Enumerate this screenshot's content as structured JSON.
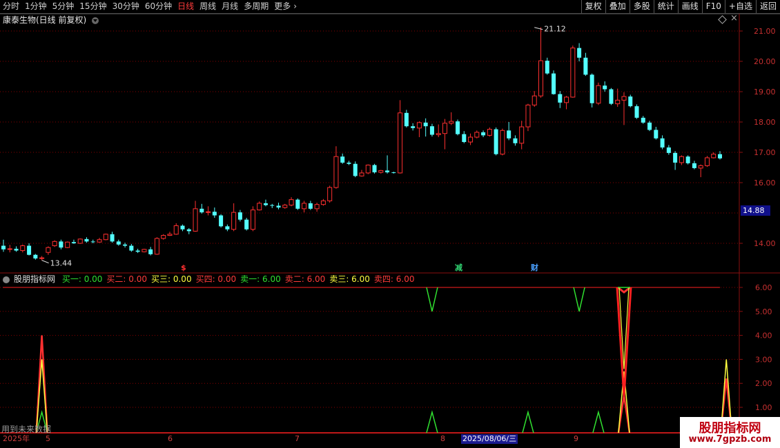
{
  "toolbar": {
    "periods": [
      "分时",
      "1分钟",
      "5分钟",
      "15分钟",
      "30分钟",
      "60分钟",
      "日线",
      "周线",
      "月线",
      "多周期",
      "更多"
    ],
    "active_period": "日线",
    "right_buttons": [
      "复权",
      "叠加",
      "多股",
      "统计",
      "画线",
      "F10",
      "+自选",
      "返回"
    ],
    "more_arrow": "›"
  },
  "main_chart": {
    "title": "康泰生物(日线 前复权)",
    "high_label": "21.12",
    "low_label": "13.44",
    "current_price": "14.88",
    "y_ticks": [
      "21.00",
      "20.00",
      "19.00",
      "18.00",
      "17.00",
      "16.00",
      "14.00"
    ],
    "markers": [
      {
        "label": "$",
        "color": "#ff3030"
      },
      {
        "label": "减",
        "color": "#30d070"
      },
      {
        "label": "财",
        "color": "#4aa0ff"
      }
    ],
    "close_symbol": "×"
  },
  "indicator": {
    "name": "股朋指标网",
    "values": [
      {
        "label": "买一: 0.00",
        "color": "#30e030"
      },
      {
        "label": "买二: 0.00",
        "color": "#ff3b3b"
      },
      {
        "label": "买三: 0.00",
        "color": "#ffff40"
      },
      {
        "label": "买四: 0.00",
        "color": "#ff3b3b"
      },
      {
        "label": "卖一: 6.00",
        "color": "#30e030"
      },
      {
        "label": "卖二: 6.00",
        "color": "#ff3b3b"
      },
      {
        "label": "卖三: 6.00",
        "color": "#ffff40"
      },
      {
        "label": "卖四: 6.00",
        "color": "#ff3b3b"
      }
    ],
    "y_ticks": [
      "6.00",
      "5.00",
      "4.00",
      "3.00",
      "2.00",
      "1.00"
    ]
  },
  "footer_note": "用到未来数据",
  "date_axis": {
    "labels": [
      "2025年",
      "5",
      "6",
      "7",
      "8",
      "2025/08/06/三",
      "9"
    ]
  },
  "watermark": {
    "title": "股朋指标网",
    "url": "www.7gpzb.com"
  },
  "colors": {
    "up": "#ff3030",
    "down": "#54ffff",
    "grid": "#8b0000",
    "accent": "#10108a"
  },
  "chart_data": {
    "type": "candlestick",
    "ylim": [
      13.2,
      21.5
    ],
    "ohlc": [
      [
        13.92,
        14.12,
        13.72,
        13.8
      ],
      [
        13.8,
        13.95,
        13.7,
        13.82
      ],
      [
        13.82,
        13.9,
        13.72,
        13.76
      ],
      [
        13.76,
        13.96,
        13.7,
        13.92
      ],
      [
        13.92,
        14.0,
        13.6,
        13.62
      ],
      [
        13.62,
        13.65,
        13.46,
        13.5
      ],
      [
        13.5,
        13.58,
        13.44,
        13.52
      ],
      [
        13.7,
        13.9,
        13.62,
        13.86
      ],
      [
        13.92,
        14.1,
        13.88,
        14.06
      ],
      [
        14.06,
        14.12,
        13.8,
        13.86
      ],
      [
        13.86,
        14.06,
        13.84,
        14.04
      ],
      [
        14.04,
        14.12,
        13.98,
        14.0
      ],
      [
        14.0,
        14.16,
        13.98,
        14.14
      ],
      [
        14.14,
        14.2,
        14.02,
        14.06
      ],
      [
        14.06,
        14.12,
        14.0,
        14.04
      ],
      [
        14.04,
        14.18,
        14.02,
        14.12
      ],
      [
        14.12,
        14.32,
        14.1,
        14.3
      ],
      [
        14.3,
        14.38,
        14.02,
        14.06
      ],
      [
        14.06,
        14.12,
        13.92,
        13.96
      ],
      [
        13.96,
        14.02,
        13.86,
        13.92
      ],
      [
        13.92,
        13.98,
        13.72,
        13.76
      ],
      [
        13.76,
        13.82,
        13.68,
        13.72
      ],
      [
        13.72,
        13.82,
        13.7,
        13.8
      ],
      [
        13.8,
        13.88,
        13.6,
        13.64
      ],
      [
        13.64,
        14.2,
        13.62,
        14.16
      ],
      [
        14.16,
        14.3,
        14.12,
        14.26
      ],
      [
        14.26,
        14.38,
        14.24,
        14.3
      ],
      [
        14.3,
        14.66,
        14.28,
        14.58
      ],
      [
        14.58,
        14.62,
        14.4,
        14.46
      ],
      [
        14.46,
        14.5,
        14.3,
        14.4
      ],
      [
        14.4,
        15.4,
        14.38,
        15.14
      ],
      [
        15.14,
        15.3,
        14.98,
        15.02
      ],
      [
        15.02,
        15.22,
        14.92,
        15.04
      ],
      [
        15.04,
        15.18,
        14.84,
        14.92
      ],
      [
        14.92,
        14.96,
        14.52,
        14.56
      ],
      [
        14.56,
        14.62,
        14.4,
        14.46
      ],
      [
        14.46,
        15.32,
        14.4,
        15.02
      ],
      [
        15.02,
        15.1,
        14.72,
        14.78
      ],
      [
        14.78,
        14.84,
        14.42,
        14.46
      ],
      [
        14.46,
        15.22,
        14.4,
        15.1
      ],
      [
        15.1,
        15.38,
        15.08,
        15.32
      ],
      [
        15.32,
        15.44,
        15.22,
        15.26
      ],
      [
        15.26,
        15.3,
        15.16,
        15.24
      ],
      [
        15.24,
        15.34,
        15.12,
        15.18
      ],
      [
        15.18,
        15.3,
        15.14,
        15.26
      ],
      [
        15.26,
        15.52,
        15.22,
        15.44
      ],
      [
        15.44,
        15.48,
        15.1,
        15.14
      ],
      [
        15.14,
        15.4,
        15.02,
        15.32
      ],
      [
        15.32,
        15.4,
        15.1,
        15.14
      ],
      [
        15.14,
        15.34,
        15.04,
        15.28
      ],
      [
        15.28,
        15.46,
        15.24,
        15.4
      ],
      [
        15.4,
        15.9,
        15.34,
        15.84
      ],
      [
        15.84,
        17.2,
        15.8,
        16.86
      ],
      [
        16.86,
        16.96,
        16.62,
        16.66
      ],
      [
        16.66,
        16.72,
        16.58,
        16.62
      ],
      [
        16.62,
        16.7,
        16.18,
        16.22
      ],
      [
        16.22,
        16.42,
        16.2,
        16.32
      ],
      [
        16.32,
        16.6,
        16.28,
        16.58
      ],
      [
        16.58,
        16.62,
        16.3,
        16.34
      ],
      [
        16.34,
        16.42,
        16.3,
        16.4
      ],
      [
        16.4,
        16.9,
        16.3,
        16.34
      ],
      [
        16.34,
        16.36,
        16.3,
        16.32
      ],
      [
        16.32,
        18.72,
        16.3,
        18.3
      ],
      [
        18.3,
        18.4,
        17.82,
        17.86
      ],
      [
        17.86,
        17.96,
        17.72,
        17.8
      ],
      [
        17.8,
        18.02,
        17.5,
        17.98
      ],
      [
        17.98,
        18.12,
        17.52,
        17.86
      ],
      [
        17.86,
        17.94,
        17.52,
        17.58
      ],
      [
        17.58,
        17.92,
        17.5,
        17.62
      ],
      [
        17.62,
        18.1,
        17.1,
        17.96
      ],
      [
        17.96,
        18.32,
        17.9,
        18.02
      ],
      [
        18.02,
        18.08,
        17.56,
        17.6
      ],
      [
        17.6,
        17.7,
        17.3,
        17.34
      ],
      [
        17.34,
        17.62,
        17.24,
        17.5
      ],
      [
        17.5,
        17.72,
        17.46,
        17.66
      ],
      [
        17.66,
        17.72,
        17.5,
        17.56
      ],
      [
        17.56,
        17.82,
        17.52,
        17.76
      ],
      [
        17.76,
        17.82,
        16.9,
        16.94
      ],
      [
        16.94,
        17.78,
        16.9,
        17.72
      ],
      [
        17.72,
        18.0,
        17.4,
        17.46
      ],
      [
        17.46,
        17.56,
        17.22,
        17.3
      ],
      [
        17.3,
        18.04,
        17.1,
        17.84
      ],
      [
        17.84,
        18.6,
        17.7,
        18.56
      ],
      [
        18.56,
        19.02,
        18.5,
        18.86
      ],
      [
        18.86,
        21.12,
        18.8,
        20.02
      ],
      [
        20.02,
        20.12,
        19.56,
        19.6
      ],
      [
        19.6,
        19.7,
        18.9,
        18.92
      ],
      [
        18.92,
        19.02,
        18.46,
        18.64
      ],
      [
        18.64,
        18.86,
        18.42,
        18.82
      ],
      [
        18.82,
        20.52,
        18.8,
        20.44
      ],
      [
        20.44,
        20.6,
        20.0,
        20.12
      ],
      [
        20.12,
        20.28,
        19.52,
        19.56
      ],
      [
        19.56,
        19.6,
        18.48,
        18.62
      ],
      [
        18.62,
        19.3,
        18.56,
        19.2
      ],
      [
        19.2,
        19.34,
        19.0,
        19.08
      ],
      [
        19.08,
        19.12,
        18.56,
        18.6
      ],
      [
        18.6,
        19.1,
        18.5,
        18.72
      ],
      [
        18.72,
        18.98,
        17.9,
        18.84
      ],
      [
        18.84,
        18.9,
        18.48,
        18.52
      ],
      [
        18.52,
        18.58,
        18.1,
        18.14
      ],
      [
        18.14,
        18.2,
        17.94,
        17.98
      ],
      [
        17.98,
        18.04,
        17.7,
        17.74
      ],
      [
        17.74,
        17.84,
        17.42,
        17.46
      ],
      [
        17.46,
        17.56,
        17.1,
        17.16
      ],
      [
        17.16,
        17.24,
        16.92,
        16.98
      ],
      [
        16.98,
        17.04,
        16.42,
        16.66
      ],
      [
        16.66,
        16.9,
        16.58,
        16.86
      ],
      [
        16.86,
        16.9,
        16.6,
        16.64
      ],
      [
        16.64,
        16.72,
        16.44,
        16.48
      ],
      [
        16.48,
        16.6,
        16.18,
        16.56
      ],
      [
        16.56,
        16.88,
        16.52,
        16.82
      ],
      [
        16.82,
        17.0,
        16.8,
        16.94
      ],
      [
        16.94,
        17.04,
        16.76,
        16.8
      ]
    ],
    "indicator_series": [
      {
        "name": "买一",
        "color": "#30e030",
        "points": [
          {
            "i": 6,
            "v": 0.8
          }
        ]
      },
      {
        "name": "买二",
        "color": "#ff3030",
        "points": [
          {
            "i": 6,
            "v": 4.0
          },
          {
            "i": 97,
            "v": 1.5
          },
          {
            "i": 113,
            "v": 2.2
          }
        ]
      },
      {
        "name": "买三",
        "color": "#ffff40",
        "points": [
          {
            "i": 6,
            "v": 3.0
          },
          {
            "i": 97,
            "v": 2.5
          },
          {
            "i": 113,
            "v": 3.0
          }
        ]
      },
      {
        "name": "卖一",
        "color": "#30e030",
        "points": [
          {
            "i": 67,
            "v": 0.8
          },
          {
            "i": 82,
            "v": 0.8
          },
          {
            "i": 93,
            "v": 0.8
          }
        ]
      },
      {
        "name": "卖二",
        "color": "#ff3030",
        "points": [
          {
            "i": 97,
            "v": 5.8
          }
        ]
      },
      {
        "name": "卖三",
        "color": "#30e030",
        "points": [
          {
            "i": 67,
            "v": 5.0
          },
          {
            "i": 90,
            "v": 5.0
          }
        ]
      }
    ]
  }
}
